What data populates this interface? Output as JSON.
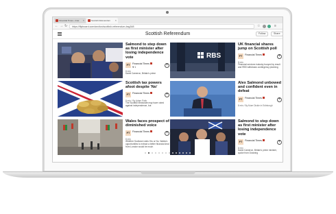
{
  "browser": {
    "tabs": [
      {
        "label": "Financial Times - Inter"
      },
      {
        "label": "Scottish Referendum"
      }
    ],
    "url": "https://flipboard.com/section/scottish-referendum-bsg348"
  },
  "header": {
    "title": "Scottish Referendum",
    "follow_label": "Follow",
    "share_label": "Share"
  },
  "articles": [
    {
      "headline": "Salmond to step down as first minister after losing independence vote",
      "source": "Financial Times",
      "logo": "FT",
      "likes": "❤ 1",
      "meta": "8 min",
      "desc": "David Cameron, Britain's prime"
    },
    {
      "headline": "UK financial shares jump on Scottish poll",
      "source": "Financial Times",
      "logo": "FT",
      "likes": "",
      "meta": "8 min",
      "desc": "Financial services industry buoyed by result and RBS withdraws contingency planning"
    },
    {
      "headline": "Scottish tax powers afoot despite 'No'",
      "source": "Financial Times",
      "logo": "FT",
      "likes": "",
      "meta": "8 min / By Adam Palin",
      "desc": "The Scottish electorate may have voted against independence, but"
    },
    {
      "headline": "Alex Salmond unbowed and confident even in defeat",
      "source": "Financial Times",
      "logo": "FT",
      "likes": "",
      "meta": "8 min / By Mure Dickie in Edinburgh",
      "desc": ""
    },
    {
      "headline": "Wales faces prospect of diminished voice",
      "source": "Financial Times",
      "logo": "FT",
      "likes": "",
      "meta": "8 min",
      "desc": "Whether Scotland votes Yes or No, Wales's opportunities to extract a better financial deal from London would be much"
    },
    {
      "headline": "Salmond to step down as first minister after losing independence vote",
      "source": "Financial Times",
      "logo": "FT",
      "likes": "",
      "meta": "8 min",
      "desc": "David Cameron, Britain's prime minister, spoke from Downing"
    }
  ],
  "pagination": {
    "current": 2,
    "total": 14
  },
  "colors": {
    "ft_logo_bg": "#f3d9bf",
    "badge": "#c0392b"
  }
}
